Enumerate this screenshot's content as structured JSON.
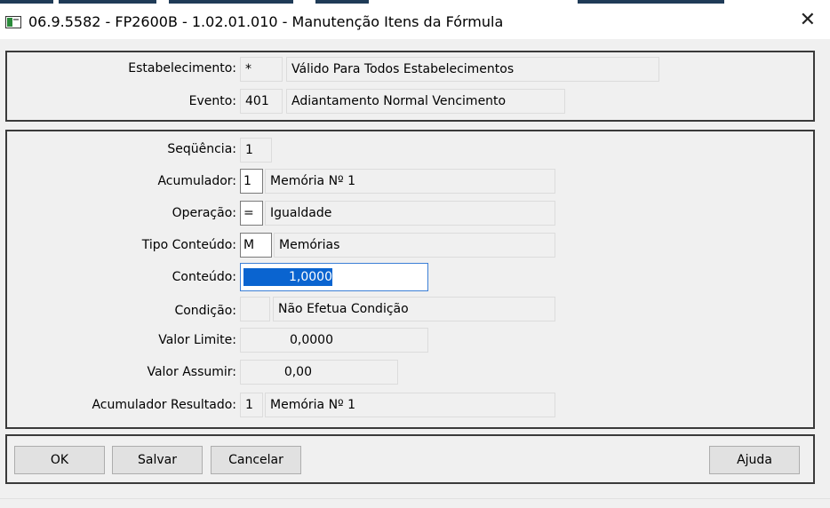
{
  "window": {
    "title": "06.9.5582 - FP2600B - 1.02.01.010 - Manutenção Itens da Fórmula",
    "close_glyph": "✕"
  },
  "header_panel": {
    "estabelecimento": {
      "label": "Estabelecimento:",
      "code": "*",
      "description": "Válido Para Todos Estabelecimentos"
    },
    "evento": {
      "label": "Evento:",
      "code": "401",
      "description": "Adiantamento Normal Vencimento"
    }
  },
  "detail_panel": {
    "sequencia": {
      "label": "Seqüência:",
      "value": "1"
    },
    "acumulador": {
      "label": "Acumulador:",
      "code": "1",
      "description": "Memória Nº 1"
    },
    "operacao": {
      "label": "Operação:",
      "code": "=",
      "description": "Igualdade"
    },
    "tipo_conteudo": {
      "label": "Tipo Conteúdo:",
      "code": "M",
      "description": "Memórias"
    },
    "conteudo": {
      "label": "Conteúdo:",
      "value": "1,0000"
    },
    "condicao": {
      "label": "Condição:",
      "code": "",
      "description": "Não Efetua Condição"
    },
    "valor_limite": {
      "label": "Valor Limite:",
      "value": "0,0000"
    },
    "valor_assumir": {
      "label": "Valor Assumir:",
      "value": "0,00"
    },
    "acumulador_resultado": {
      "label": "Acumulador Resultado:",
      "code": "1",
      "description": "Memória Nº 1"
    }
  },
  "buttons": {
    "ok": "OK",
    "salvar": "Salvar",
    "cancelar": "Cancelar",
    "ajuda": "Ajuda"
  }
}
